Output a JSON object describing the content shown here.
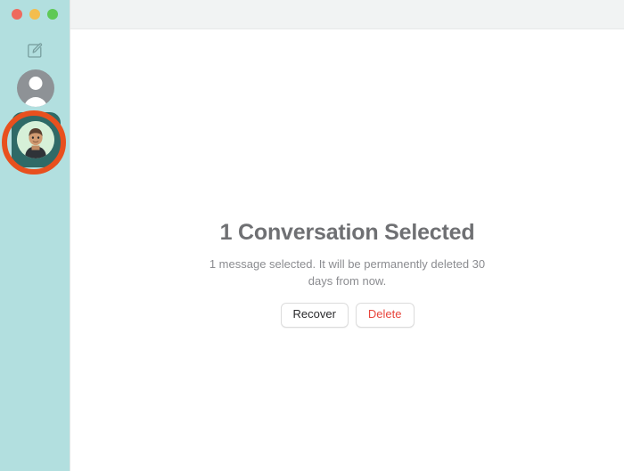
{
  "window": {
    "traffic_lights": [
      {
        "name": "close",
        "color": "#ef6a5e"
      },
      {
        "name": "minimize",
        "color": "#f4bd4e"
      },
      {
        "name": "maximize",
        "color": "#5fc956"
      }
    ]
  },
  "sidebar": {
    "background_color": "#b2dfdf",
    "compose_icon": "compose-icon",
    "accounts": [
      {
        "name": "placeholder-account",
        "avatar_type": "person-silhouette",
        "selected": false
      },
      {
        "name": "memoji-account",
        "avatar_type": "memoji",
        "selected": true,
        "selection_color": "#2f6a67"
      }
    ],
    "annotation": {
      "type": "highlight-ring",
      "color": "#e8501e",
      "target": "memoji-account"
    }
  },
  "main": {
    "empty_state": {
      "title": "1 Conversation Selected",
      "subtitle": "1 message selected. It will be permanently deleted 30 days from now.",
      "recover_label": "Recover",
      "delete_label": "Delete",
      "delete_color": "#e8453c"
    }
  }
}
